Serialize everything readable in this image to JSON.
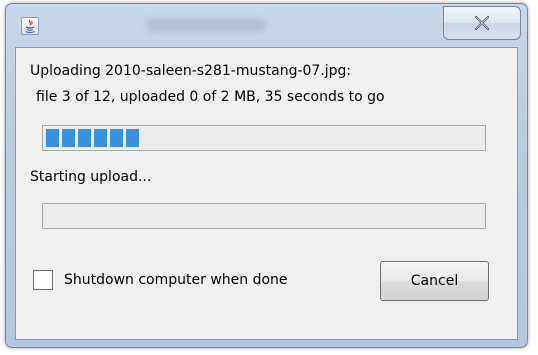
{
  "dialog": {
    "close_icon": "close-icon",
    "app_icon": "java-icon"
  },
  "upload": {
    "message_line1": "Uploading 2010-saleen-s281-mustang-07.jpg:",
    "message_line2": "file 3 of 12, uploaded 0 of 2 MB, 35 seconds to go",
    "overall_progress_fraction": 0.22,
    "status_text": "Starting upload...",
    "file_progress_fraction": 0.0
  },
  "options": {
    "shutdown_label": "Shutdown computer when done",
    "shutdown_checked": false
  },
  "buttons": {
    "cancel_label": "Cancel"
  },
  "colors": {
    "progress_fill": "#3a8fde",
    "dialog_background": "#f0f0f0"
  }
}
